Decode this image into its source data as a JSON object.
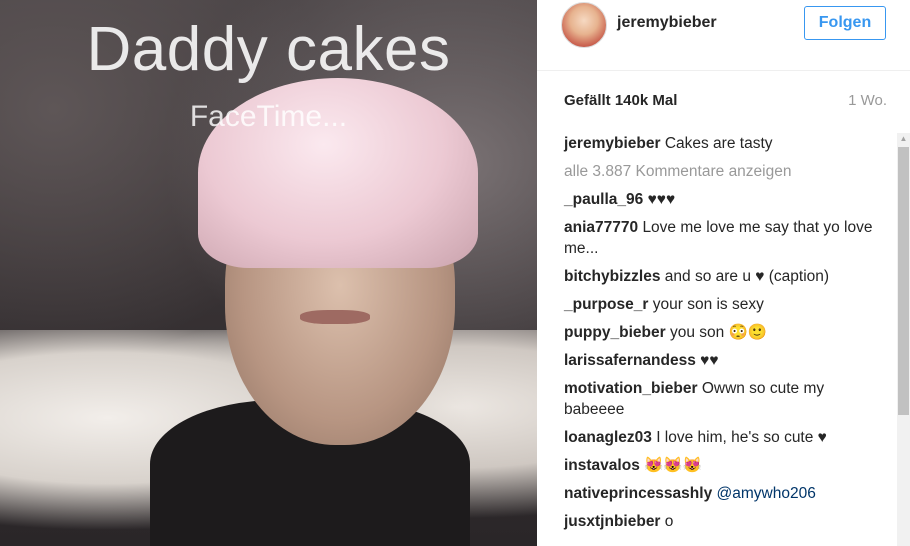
{
  "photo": {
    "caption_title": "Daddy cakes",
    "caption_subtitle": "FaceTime..."
  },
  "header": {
    "username": "jeremybieber",
    "follow_label": "Folgen"
  },
  "stats": {
    "likes": "Gefällt 140k Mal",
    "time_ago": "1 Wo."
  },
  "comments": {
    "caption": {
      "user": "jeremybieber",
      "text": "Cakes are tasty"
    },
    "load_more": "alle 3.887 Kommentare anzeigen",
    "items": [
      {
        "user": "_paulla_96",
        "text": "♥♥♥"
      },
      {
        "user": "ania77770",
        "text": "Love me love me say that yo love me..."
      },
      {
        "user": "bitchybizzles",
        "text": "and so are u ♥ (caption)"
      },
      {
        "user": "_purpose_r",
        "text": "your son is sexy"
      },
      {
        "user": "puppy_bieber",
        "text": "you son 😳🙂"
      },
      {
        "user": "larissafernandess",
        "text": "♥♥"
      },
      {
        "user": "motivation_bieber",
        "text": "Owwn so cute my babeeee"
      },
      {
        "user": "loanaglez03",
        "text": "I love him, he's so cute ♥"
      },
      {
        "user": "instavalos",
        "text": "😻😻😻"
      },
      {
        "user": "nativeprincessashly",
        "text": "@amywho206"
      },
      {
        "user": "jusxtjnbieber",
        "text": "o"
      }
    ]
  },
  "colors": {
    "link": "#3897f0",
    "mention": "#003569",
    "muted": "#999999"
  }
}
